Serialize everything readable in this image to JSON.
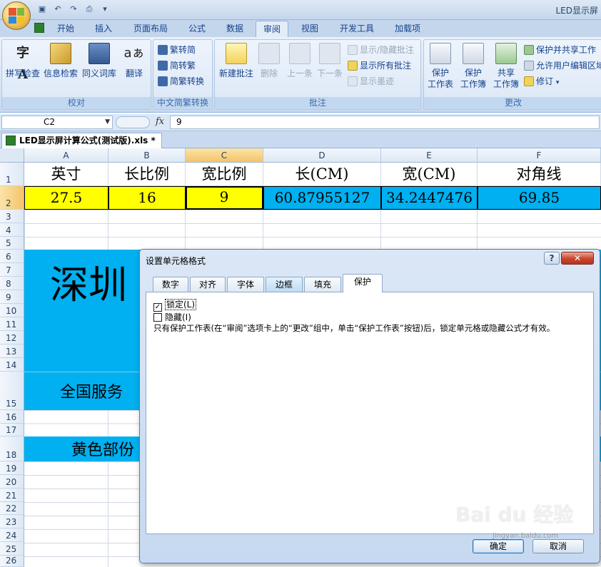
{
  "app": {
    "title": "LED显示屏",
    "quick_access": [
      "save-icon",
      "undo-icon",
      "redo-icon",
      "print-preview-icon",
      "customize-icon"
    ]
  },
  "ribbon_tabs": [
    "开始",
    "插入",
    "页面布局",
    "公式",
    "数据",
    "审阅",
    "视图",
    "开发工具",
    "加载项"
  ],
  "active_tab": "审阅",
  "ribbon": {
    "proofing": {
      "label": "校对",
      "buttons": [
        "拼写检查",
        "信息检索",
        "同义词库",
        "翻译"
      ]
    },
    "chinese_conversion": {
      "label": "中文简繁转换",
      "items": [
        "繁转简",
        "简转繁",
        "简繁转换"
      ]
    },
    "comments": {
      "label": "批注",
      "new_comment": "新建批注",
      "delete": "删除",
      "previous": "上一条",
      "next": "下一条",
      "show_hide": "显示/隐藏批注",
      "show_all": "显示所有批注",
      "show_ink": "显示墨迹"
    },
    "changes": {
      "label": "更改",
      "protect_sheet": [
        "保护",
        "工作表"
      ],
      "protect_workbook": [
        "保护",
        "工作簿"
      ],
      "share_workbook": [
        "共享",
        "工作簿"
      ],
      "protect_share": "保护并共享工作",
      "allow_edit": "允许用户编辑区域",
      "track_changes": "修订"
    }
  },
  "formula_bar": {
    "name_box": "C2",
    "fx": "fx",
    "value": "9"
  },
  "workbook_tab": "LED显示屏计算公式(测试版).xls *",
  "sheet": {
    "columns": [
      "A",
      "B",
      "C",
      "D",
      "E",
      "F"
    ],
    "rows": [
      "1",
      "2",
      "3",
      "4",
      "5",
      "6",
      "7",
      "8",
      "9",
      "10",
      "11",
      "12",
      "13",
      "14",
      "15",
      "16",
      "17",
      "18",
      "19",
      "20",
      "21",
      "22",
      "23",
      "24",
      "25",
      "26"
    ],
    "headers": [
      "英寸",
      "长比例",
      "宽比例",
      "长(CM)",
      "宽(CM)",
      "对角线"
    ],
    "values": [
      "27.5",
      "16",
      "9",
      "60.87955127",
      "34.2447476",
      "69.85"
    ],
    "banner1": "深圳",
    "banner2": "全国服务",
    "banner3": "黄色部份",
    "colors": {
      "yellow": "#ffff00",
      "blue": "#00b0f0"
    }
  },
  "dialog": {
    "title": "设置单元格格式",
    "help": "?",
    "close": "✕",
    "tabs": [
      "数字",
      "对齐",
      "字体",
      "边框",
      "填充",
      "保护"
    ],
    "active_tab": "保护",
    "locked_label": "锁定(L)",
    "locked_checked": true,
    "hidden_label": "隐藏(I)",
    "hidden_checked": false,
    "note": "只有保护工作表(在“审阅”选项卡上的“更改”组中，单击“保护工作表”按钮)后，锁定单元格或隐藏公式才有效。",
    "ok": "确定",
    "cancel": "取消"
  },
  "watermark": {
    "text": "Bai du 经验",
    "sub": "jingyan.baidu.com"
  }
}
